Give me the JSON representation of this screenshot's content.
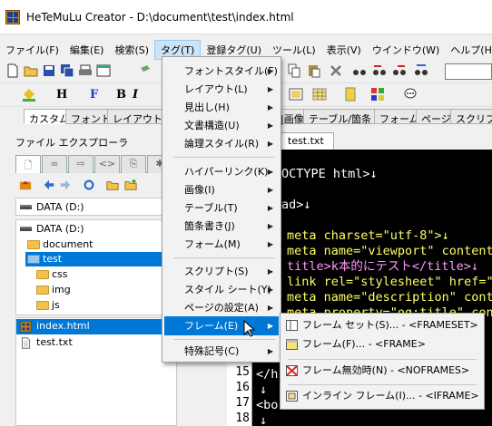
{
  "window": {
    "title": "HeTeMuLu Creator - D:\\document\\test\\index.html"
  },
  "menubar": [
    "ファイル(F)",
    "編集(E)",
    "検索(S)",
    "タグ(T)",
    "登録タグ(U)",
    "ツール(L)",
    "表示(V)",
    "ウインドウ(W)",
    "ヘルプ(H)"
  ],
  "palette_tabs": [
    "カスタム",
    "フォント",
    "レイアウト",
    "|画像",
    "テーブル/箇条",
    "フォーム",
    "ページ",
    "スクリプト"
  ],
  "toolbar2": {
    "heading_label": "H",
    "font_label": "F",
    "bold_label": "B",
    "italic_label": "I"
  },
  "explorer": {
    "title": "ファイル エクスプローラ",
    "drive_selector": "DATA (D:)",
    "tree": [
      "DATA (D:)",
      "document",
      "test",
      "css",
      "img",
      "js"
    ],
    "files": [
      "index.html",
      "test.txt"
    ]
  },
  "editor": {
    "tab": "test.txt",
    "line_numbers": [
      "15",
      "16",
      "17",
      "18"
    ],
    "code_lines": [
      "OCTYPE html>↓",
      "",
      "ad>↓",
      "",
      "meta charset=\"utf-8\">↓",
      "meta name=\"viewport\" content=\"",
      "title>k本的にテスト</title>↓",
      "link rel=\"stylesheet\" href=\"cs",
      "meta name=\"description\" conte",
      "meta property=\"og:title\" conte",
      "",
      "",
      "",
      "",
      "</h",
      "↓",
      "<bo",
      "↓"
    ]
  },
  "tag_menu": {
    "items": [
      {
        "label": "フォントスタイル(F)",
        "submenu": true
      },
      {
        "label": "レイアウト(L)",
        "submenu": true
      },
      {
        "label": "見出し(H)",
        "submenu": true
      },
      {
        "label": "文書構造(U)",
        "submenu": true
      },
      {
        "label": "論理スタイル(R)",
        "submenu": true
      },
      {
        "label": "ハイパーリンク(K)",
        "submenu": true
      },
      {
        "label": "画像(I)",
        "submenu": true
      },
      {
        "label": "テーブル(T)",
        "submenu": true
      },
      {
        "label": "箇条書き(J)",
        "submenu": true
      },
      {
        "label": "フォーム(M)",
        "submenu": true
      },
      {
        "label": "スクリプト(S)",
        "submenu": true
      },
      {
        "label": "スタイル シート(Y)",
        "submenu": true
      },
      {
        "label": "ページの設定(A)",
        "submenu": true
      },
      {
        "label": "フレーム(E)",
        "submenu": true
      },
      {
        "label": "特殊記号(C)",
        "submenu": true
      }
    ],
    "highlighted": "フレーム(E)"
  },
  "frame_submenu": [
    {
      "label": "フレーム セット(S)... - <FRAMESET>",
      "icon": "frameset-icon"
    },
    {
      "label": "フレーム(F)... - <FRAME>",
      "icon": "frame-icon"
    },
    {
      "label": "フレーム無効時(N) - <NOFRAMES>",
      "icon": "noframes-icon"
    },
    {
      "label": "インライン フレーム(I)... - <IFRAME>",
      "icon": "iframe-icon"
    }
  ],
  "colors": {
    "accent": "#0078d7",
    "editor_bg": "#000000",
    "menu_bg": "#f2f2f2",
    "hover": "#cce4f7"
  }
}
